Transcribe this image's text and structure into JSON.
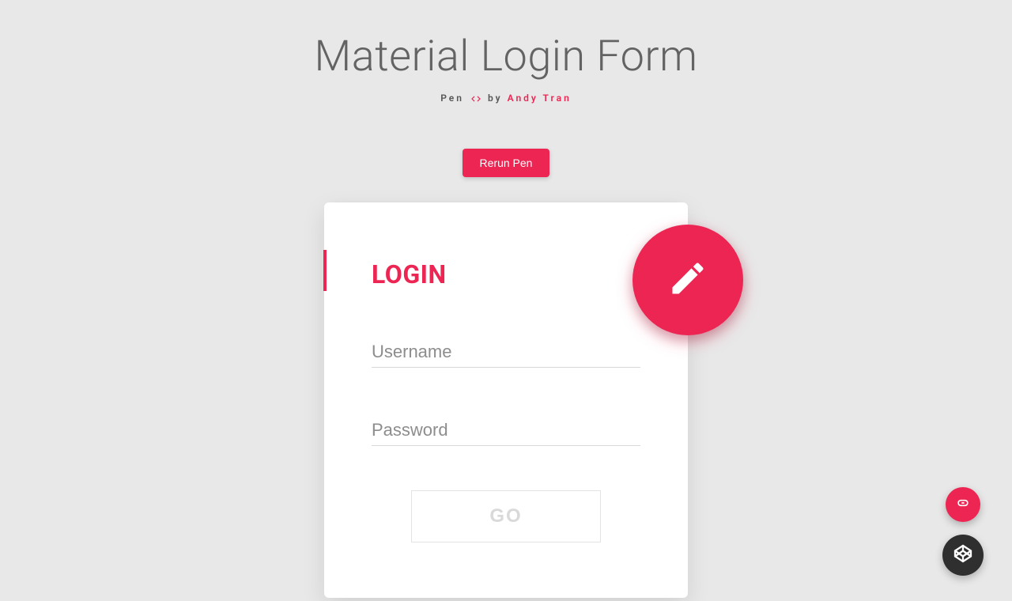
{
  "title": "Material Login Form",
  "byline": {
    "prefix": "Pen",
    "middle": "by",
    "author": "Andy Tran"
  },
  "rerun_label": "Rerun Pen",
  "card": {
    "heading": "LOGIN",
    "username_placeholder": "Username",
    "password_placeholder": "Password",
    "submit_label": "GO"
  },
  "colors": {
    "accent": "#ed2553",
    "page_bg": "#e8e8e8"
  }
}
